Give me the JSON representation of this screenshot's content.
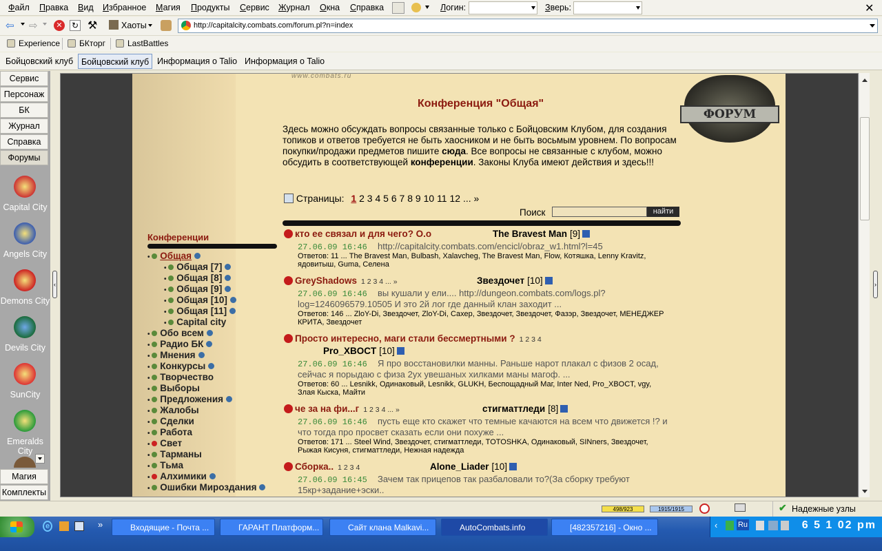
{
  "menubar": {
    "items": [
      "Файл",
      "Правка",
      "Вид",
      "Избранное",
      "Магия",
      "Продукты",
      "Сервис",
      "Журнал",
      "Окна",
      "Справка"
    ],
    "login_label": "Логин:",
    "beast_label": "Зверь:"
  },
  "toolbar": {
    "chaos_label": "Хаоты",
    "url": "http://capitalcity.combats.com/forum.pl?n=index"
  },
  "bookmarks": [
    "Experience",
    "БКторг",
    "LastBattles"
  ],
  "tabs": [
    "Бойцовский клуб",
    "Бойцовский клуб",
    "Информация о Talio",
    "Информация о Talio"
  ],
  "sidebar": {
    "buttons": [
      "Сервис",
      "Персонаж",
      "БК",
      "Журнал",
      "Справка",
      "Форумы"
    ],
    "cities": [
      "Capital City",
      "Angels City",
      "Demons City",
      "Devils City",
      "SunCity",
      "Emeralds City"
    ],
    "bottom_buttons": [
      "Магия",
      "Комплекты"
    ]
  },
  "forum": {
    "logo_text": "ФОРУМ",
    "title": "Конференция \"Общая\"",
    "intro_1": "Здесь можно обсуждать вопросы связанные только с Бойцовским Клубом, для создания топиков и ответов требуется не быть хаосником и не быть восьмым уровнем. По вопросам покупки/продажи предметов пишите ",
    "intro_link1": "сюда",
    "intro_2": ". Все вопросы не связанные с клубом, можно обсудить в соответствующей ",
    "intro_link2": "конференции",
    "intro_3": ". Законы Клуба имеют действия и здесь!!!",
    "pages_label": "Страницы:",
    "pages": [
      "1",
      "2",
      "3",
      "4",
      "5",
      "6",
      "7",
      "8",
      "9",
      "10",
      "11",
      "12",
      "...",
      "»"
    ],
    "search_label": "Поиск",
    "search_button": "найти",
    "conferences_title": "Конференции",
    "conferences": [
      {
        "name": "Общая",
        "level": 0,
        "red": false,
        "glob": true,
        "current": true
      },
      {
        "name": "Общая [7]",
        "level": 1,
        "red": false,
        "glob": true
      },
      {
        "name": "Общая [8]",
        "level": 1,
        "red": false,
        "glob": true
      },
      {
        "name": "Общая [9]",
        "level": 1,
        "red": false,
        "glob": true
      },
      {
        "name": "Общая [10]",
        "level": 1,
        "red": false,
        "glob": true
      },
      {
        "name": "Общая [11]",
        "level": 1,
        "red": false,
        "glob": true
      },
      {
        "name": "Capital city",
        "level": 1,
        "red": false,
        "glob": false
      },
      {
        "name": "Обо всем",
        "level": 0,
        "red": false,
        "glob": true
      },
      {
        "name": "Радио БК",
        "level": 0,
        "red": false,
        "glob": true
      },
      {
        "name": "Мнения",
        "level": 0,
        "red": false,
        "glob": true
      },
      {
        "name": "Конкурсы",
        "level": 0,
        "red": false,
        "glob": true
      },
      {
        "name": "Творчество",
        "level": 0,
        "red": false,
        "glob": false
      },
      {
        "name": "Выборы",
        "level": 0,
        "red": false,
        "glob": false
      },
      {
        "name": "Предложения",
        "level": 0,
        "red": false,
        "glob": true
      },
      {
        "name": "Жалобы",
        "level": 0,
        "red": false,
        "glob": false
      },
      {
        "name": "Сделки",
        "level": 0,
        "red": false,
        "glob": false
      },
      {
        "name": "Работа",
        "level": 0,
        "red": false,
        "glob": false
      },
      {
        "name": "Свет",
        "level": 0,
        "red": true,
        "glob": false
      },
      {
        "name": "Тарманы",
        "level": 0,
        "red": false,
        "glob": false
      },
      {
        "name": "Тьма",
        "level": 0,
        "red": false,
        "glob": false
      },
      {
        "name": "Алхимики",
        "level": 0,
        "red": true,
        "glob": true
      },
      {
        "name": "Ошибки Мироздания",
        "level": 0,
        "red": false,
        "glob": true
      }
    ],
    "topics": [
      {
        "title": "кто ее связал и для чего? О.о",
        "pages": "",
        "author": "The Bravest Man",
        "level": "[9]",
        "date": "27.06.09 16:46",
        "snippet": "http://capitalcity.combats.com/encicl/obraz_w1.html?l=45",
        "answers": "Ответов: 11   ... The Bravest Man, Bulbash, Xalavcheg, The Bravest Man, Flow, Котяшка, Lenny Kravitz, ядовитыш, Guma, Селена"
      },
      {
        "title": "GreyShadows",
        "pages": "1 2 3 4 ... »",
        "author": "Звездочет",
        "level": "[10]",
        "date": "27.06.09 16:46",
        "snippet": "вы кушали у ели.... http://dungeon.combats.com/logs.pl?log=1246096579.10505 И это 2й лог где данный клан заходит ...",
        "answers": "Ответов: 146   ... ZloY-Di, Звездочет, ZloY-Di, Сахер, Звездочет, Звездочет, Фазэр, Звездочет, МЕНЕДЖЕР КРИТА, Звездочет"
      },
      {
        "title": "Просто интересно, маги стали бессмертными ?",
        "pages": "1 2 3 4",
        "author": "Pro_XBOCT",
        "level": "[10]",
        "date": "27.06.09 16:46",
        "snippet": "Я про восстановилки манны. Раньше нарот плакал с физов 2 осад, сейчас я порыдаю с физа 2ух увешаных хилками маны магоф. ...",
        "answers": "Ответов: 60   ... Lesnikk, Одинаковый, Lesnikk, GLUKH, Беспощадный Маг, Inter Ned, Pro_XBOCT, vgy, Злая Кыска, Майти"
      },
      {
        "title": "че за на фи...г",
        "pages": "1 2 3 4 ... »",
        "author": "стигматтледи",
        "level": "[8]",
        "date": "27.06.09 16:46",
        "snippet": "пусть еще кто скажет что темные качаются на всем что движется !? и что тогда про просвет сказать если они похуже ...",
        "answers": "Ответов: 171   ... Steel Wind, Звездочет, стигматтледи, TOTOSHKA, Одинаковый, SINners, Звездочет, Рыжая Кисуня, стигматтледи, Нежная надежда"
      },
      {
        "title": "Сборка..",
        "pages": "1 2 3 4",
        "author": "Alone_Liader",
        "level": "[10]",
        "date": "27.06.09 16:45",
        "snippet": "Зачем так прицепов так разбаловали то?(За сборку требуют 15кр+задание+эски..",
        "answers": ""
      }
    ]
  },
  "statusbar": {
    "hp": "498/923",
    "mana": "1915/1915",
    "zone": "Надежные узлы"
  },
  "taskbar": {
    "tasks": [
      "Входящие - Почта ...",
      "ГАРАНТ Платформ...",
      "Сайт клана Malkavi...",
      "AutoCombats.info",
      "[482357216] - Окно ..."
    ],
    "lang": "Ru",
    "clock": "6 5 1 02 pm"
  },
  "colors": {
    "accent": "#8b1a0f",
    "parchment": "#f3e3b4",
    "date_green": "#3a8a3a"
  }
}
